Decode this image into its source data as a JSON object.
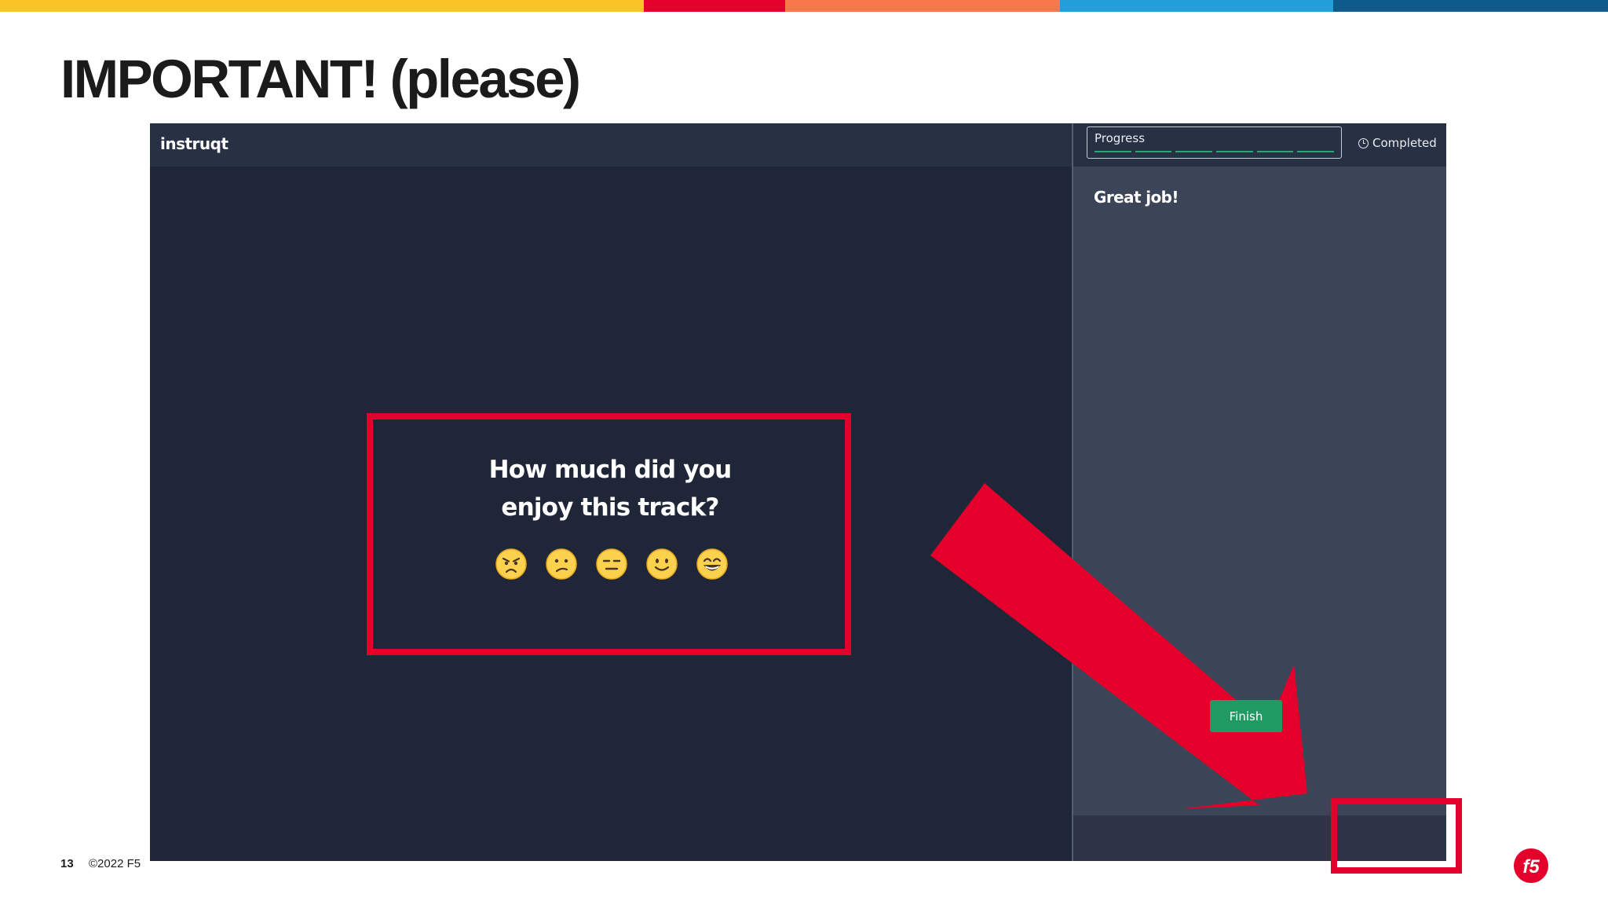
{
  "slide": {
    "title": "IMPORTANT! (please)",
    "page_number": "13",
    "copyright": "©2022 F5",
    "logo_text": "f5",
    "stripe_colors": [
      "#fbc425",
      "#e4002b",
      "#f7784a",
      "#219fd9",
      "#0e5a8c"
    ],
    "accent_color": "#e4002b"
  },
  "app": {
    "brand": "instruqt",
    "sidebar": {
      "progress_label": "Progress",
      "progress_segments_completed": 6,
      "progress_segments_total": 6,
      "status_label": "Completed",
      "status_icon": "clock-icon",
      "message": "Great job!",
      "finish_label": "Finish"
    },
    "rating": {
      "question_line1": "How much did you",
      "question_line2": "enjoy this track?",
      "options": [
        "angry-face-icon",
        "confused-face-icon",
        "expressionless-face-icon",
        "slightly-smiling-face-icon",
        "grinning-face-icon"
      ]
    }
  }
}
